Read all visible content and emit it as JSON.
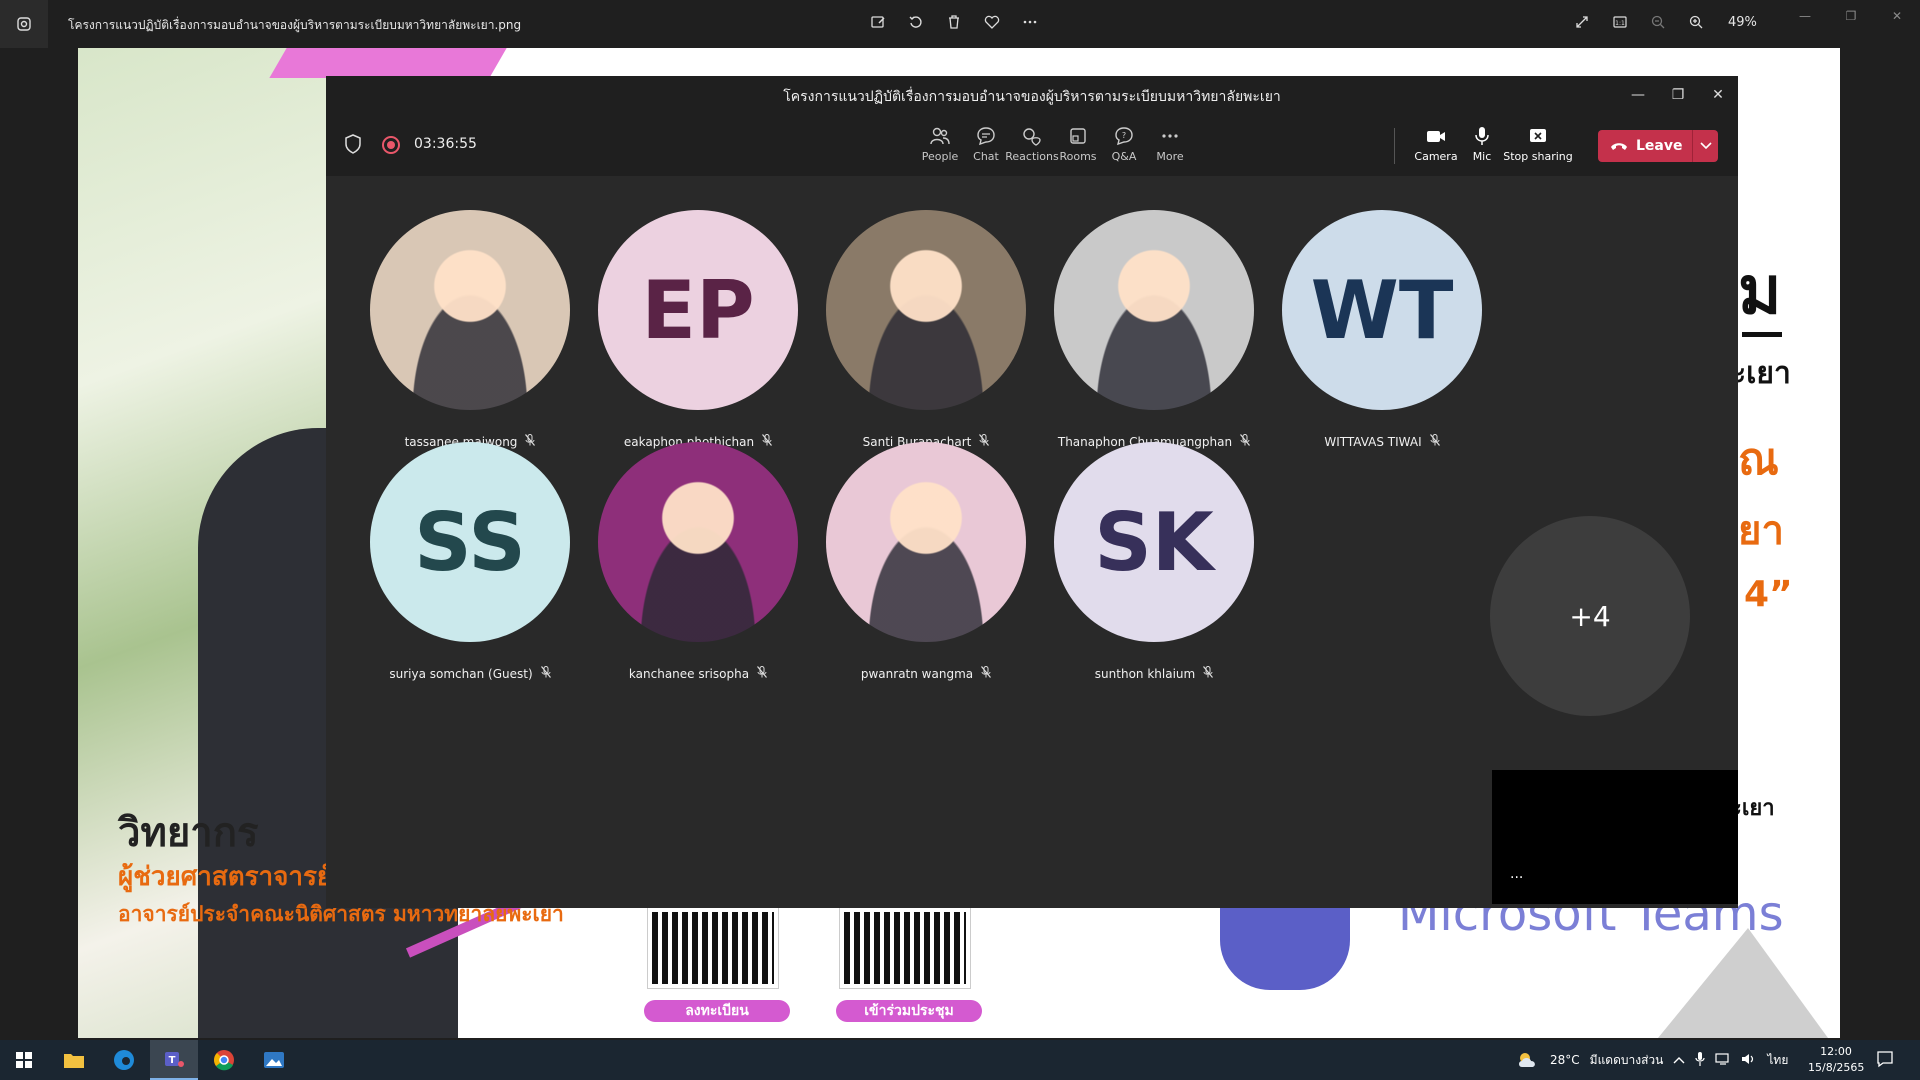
{
  "viewer": {
    "filename": "โครงการแนวปฏิบัติเรื่องการมอบอำนาจของผู้บริหารตามระเบียบมหาวิทยาลัยพะเยา.png",
    "zoom": "49%"
  },
  "poster": {
    "speaker_heading": "วิทยากร",
    "speaker_rank": "ผู้ช่วยศาสตราจารย์",
    "speaker_affiliation": "อาจารย์ประจำคณะนิติศาสตร มหาวทยาลยพะเยา",
    "right_text_1": "ม",
    "right_text_2": "ะเยา",
    "right_text_3": "ณ",
    "right_text_4": "ยา",
    "right_text_5": "4”",
    "right_text_6": "ะเยา",
    "qr_register_label": "ลงทะเบียน",
    "qr_join_label": "เข้าร่วมประชุม",
    "teams_text": "Microsoft Teams"
  },
  "teams": {
    "window_title": "โครงการแนวปฏิบัติเรื่องการมอบอำนาจของผู้บริหารตามระเบียบมหาวิทยาลัยพะเยา",
    "timer": "03:36:55",
    "tools": {
      "people": "People",
      "chat": "Chat",
      "reactions": "Reactions",
      "rooms": "Rooms",
      "qa": "Q&A",
      "more": "More",
      "camera": "Camera",
      "mic": "Mic",
      "stop_sharing": "Stop sharing",
      "leave": "Leave"
    },
    "participants": [
      {
        "name": "tassanee maiwong",
        "initials": "",
        "bg": "#d9c7b5"
      },
      {
        "name": "eakaphon phothichan",
        "initials": "EP",
        "bg": "#ecd1e0",
        "fg": "#5a2346"
      },
      {
        "name": "Santi Buranachart",
        "initials": "",
        "bg": "#8a7a68"
      },
      {
        "name": "Thanaphon Chuamuangphan",
        "initials": "",
        "bg": "#c9c9c9"
      },
      {
        "name": "WITTAVAS TIWAI",
        "initials": "WT",
        "bg": "#cddcea",
        "fg": "#1b3556"
      },
      {
        "name": "suriya somchan (Guest)",
        "initials": "SS",
        "bg": "#cbe9ec",
        "fg": "#23484d"
      },
      {
        "name": "kanchanee srisopha",
        "initials": "",
        "bg": "#8e2f7a"
      },
      {
        "name": "pwanratn wangma",
        "initials": "",
        "bg": "#e9c8d6"
      },
      {
        "name": "sunthon khlaium",
        "initials": "SK",
        "bg": "#e1dcec",
        "fg": "#37305a"
      }
    ],
    "overflow_count": "+4",
    "self_view_more": "..."
  },
  "taskbar": {
    "weather": "28°C",
    "weather_desc": "มีแดดบางส่วน",
    "lang": "ไทย",
    "time": "12:00",
    "date": "15/8/2565"
  }
}
